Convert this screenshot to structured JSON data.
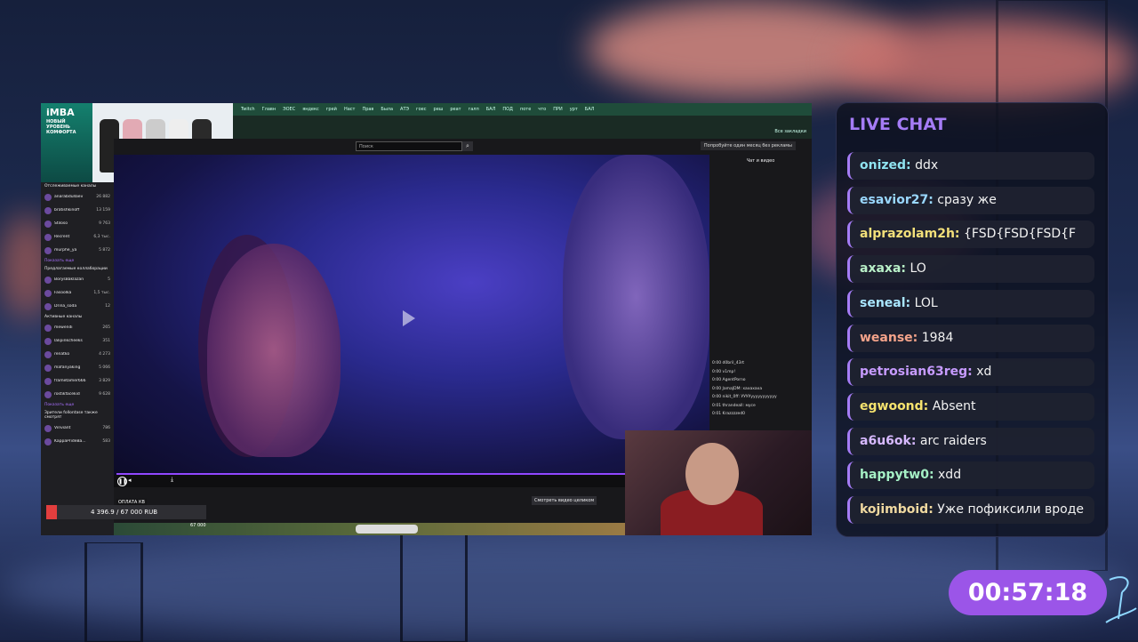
{
  "browser": {
    "tabs": [
      "Twitch",
      "Главн",
      "ЭОЕС",
      "яндекс",
      "грей",
      "Наст",
      "Прав",
      "Была",
      "АТЭ",
      "гоес",
      "реш",
      "реат",
      "галп",
      "БАЛ",
      "ПОД",
      "поте",
      "что",
      "ПРИ",
      "урт",
      "БАЛ"
    ],
    "bookmarks_label": "Все закладки"
  },
  "twitch": {
    "search_placeholder": "Поиск",
    "promo": "Попробуйте один месяц без рекламы",
    "chat_title": "Чат и видео",
    "watch_full": "Смотреть видео целиком"
  },
  "ad": {
    "brand": "iMBA",
    "tagline": "НОВЫЙ УРОВЕНЬ КОМФОРТА"
  },
  "sidebar": {
    "followed_header": "Отслеживаемые каналы",
    "followed": [
      {
        "name": "anarabdullaev",
        "count": "26 882"
      },
      {
        "name": "bratishkinoff",
        "count": "13 159"
      },
      {
        "name": "Stiloso",
        "count": "9 763"
      },
      {
        "name": "Recrent",
        "count": "6,3 тыс."
      },
      {
        "name": "murphe_ya",
        "count": "5 872"
      }
    ],
    "show_more": "Показать еще",
    "suggested_header": "Предлагаемые коллаборации",
    "suggested": [
      {
        "name": "BorysBaklazan",
        "count": "5"
      },
      {
        "name": "Fasoolka",
        "count": "1,5 тыс."
      },
      {
        "name": "Drina_soda",
        "count": "12"
      }
    ],
    "active_header": "Активные каналы",
    "active": [
      {
        "name": "mewendi",
        "count": "265"
      },
      {
        "name": "lalipinkcheeks",
        "count": "351"
      },
      {
        "name": "renatko",
        "count": "4 273"
      },
      {
        "name": "mafanyaking",
        "count": "5 066"
      },
      {
        "name": "frametamer666",
        "count": "3 829"
      },
      {
        "name": "rostikfacekid",
        "count": "9 628"
      }
    ],
    "viewers_header": "Зрители follontase также смотрят",
    "viewers": [
      {
        "name": "Vinviant",
        "count": "786"
      },
      {
        "name": "KappaPrideBa...",
        "count": "583"
      }
    ]
  },
  "mini_chat": [
    {
      "time": "0:00",
      "text": "d0bril_43rt"
    },
    {
      "time": "0:00",
      "text": "v1mp!"
    },
    {
      "time": "0:00",
      "text": "AgentPorno"
    },
    {
      "time": "0:00",
      "text": "JamaJDM: хахахаха"
    },
    {
      "time": "0:00",
      "text": "nikit_0ff: УУУУууууууууууу"
    },
    {
      "time": "0:01",
      "text": "thrandeall: мусе"
    },
    {
      "time": "0:01",
      "text": "Krazzzzed0"
    }
  ],
  "donation": {
    "label": "ОПЛАТА КВ",
    "amount": "4 396.9 / 67 000 RUB",
    "side": "67 000",
    "progress": 0.066
  },
  "live_chat": {
    "title": "LIVE CHAT",
    "messages": [
      {
        "user": "onized:",
        "text": "ddx",
        "color": "#8fe3f0"
      },
      {
        "user": "esavior27:",
        "text": "сразу же",
        "color": "#9ad8ff"
      },
      {
        "user": "alprazolam2h:",
        "text": "{FSD{FSD{FSD{F",
        "color": "#f3e07a"
      },
      {
        "user": "axaxa:",
        "text": "LO",
        "color": "#b9f0c8"
      },
      {
        "user": "seneal:",
        "text": "LOL",
        "color": "#a9e6ff"
      },
      {
        "user": "weanse:",
        "text": "1984",
        "color": "#f4a38a"
      },
      {
        "user": "petrosian63reg:",
        "text": "xd",
        "color": "#c79bff"
      },
      {
        "user": "egwoond:",
        "text": "Absent",
        "color": "#f6e36e"
      },
      {
        "user": "a6u6ok:",
        "text": "arc raiders",
        "color": "#d7b9ff"
      },
      {
        "user": "happytw0:",
        "text": "xdd",
        "color": "#a5f0c5"
      },
      {
        "user": "kojimboid:",
        "text": "Уже пофиксили вроде",
        "color": "#f0d9a0"
      }
    ]
  },
  "timer": "00:57:18"
}
